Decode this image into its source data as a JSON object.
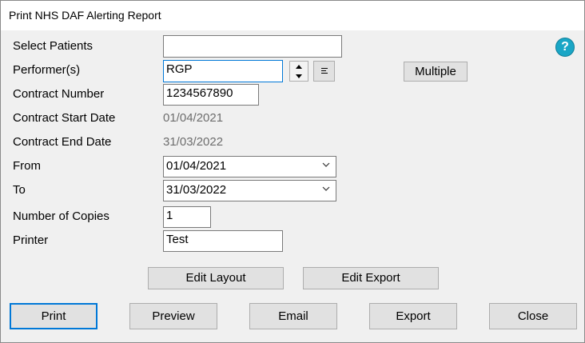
{
  "window": {
    "title": "Print NHS DAF Alerting Report"
  },
  "labels": {
    "select_patients": "Select Patients",
    "performers": "Performer(s)",
    "contract_number": "Contract Number",
    "contract_start": "Contract Start Date",
    "contract_end": "Contract End Date",
    "from": "From",
    "to": "To",
    "copies": "Number of Copies",
    "printer": "Printer"
  },
  "fields": {
    "select_patients": "",
    "performer": "RGP",
    "contract_number": "1234567890",
    "contract_start": "01/04/2021",
    "contract_end": "31/03/2022",
    "from": "01/04/2021",
    "to": "31/03/2022",
    "copies": "1",
    "printer": "Test"
  },
  "buttons": {
    "multiple": "Multiple",
    "edit_layout": "Edit Layout",
    "edit_export": "Edit Export",
    "print": "Print",
    "preview": "Preview",
    "email": "Email",
    "export": "Export",
    "close": "Close"
  },
  "help": {
    "glyph": "?"
  },
  "colors": {
    "accent": "#0078d7",
    "help": "#1aa6c6"
  }
}
